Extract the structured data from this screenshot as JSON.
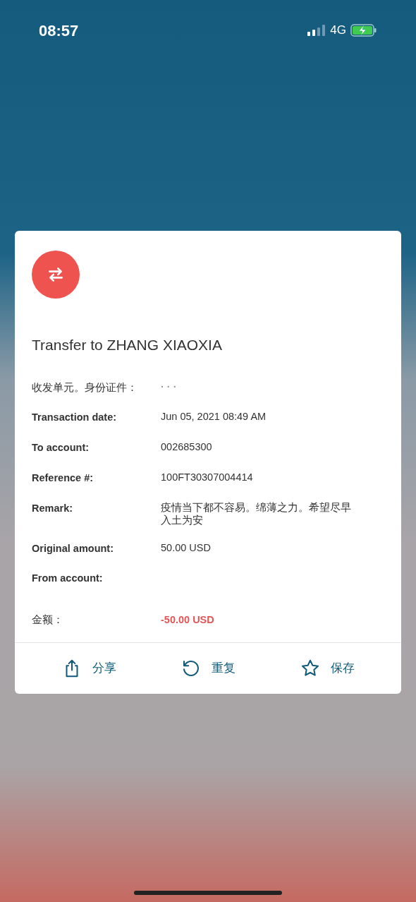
{
  "status_bar": {
    "time": "08:57",
    "network": "4G"
  },
  "receipt": {
    "title": "Transfer to ZHANG XIAOXIA",
    "details": [
      {
        "label": "收发单元。身份证件：",
        "label_bold": false,
        "value": "· · ·",
        "faint": true
      },
      {
        "label": "Transaction date:",
        "label_bold": true,
        "value": "Jun 05, 2021 08:49 AM",
        "faint": false
      },
      {
        "label": "To account:",
        "label_bold": true,
        "value": "002685300",
        "faint": false
      },
      {
        "label": "Reference #:",
        "label_bold": true,
        "value": "100FT30307004414",
        "faint": false
      },
      {
        "label": "Remark:",
        "label_bold": true,
        "value": "疫情当下都不容易。绵薄之力。希望尽早入土为安",
        "faint": false
      },
      {
        "label": "Original amount:",
        "label_bold": true,
        "value": "50.00 USD",
        "faint": false
      },
      {
        "label": "From account:",
        "label_bold": true
      }
    ],
    "amount": {
      "label": "金额：",
      "value": "-50.00 USD"
    },
    "actions": [
      {
        "kind": "share",
        "label": "分享"
      },
      {
        "kind": "repeat",
        "label": "重复"
      },
      {
        "kind": "star",
        "label": "保存"
      }
    ]
  }
}
